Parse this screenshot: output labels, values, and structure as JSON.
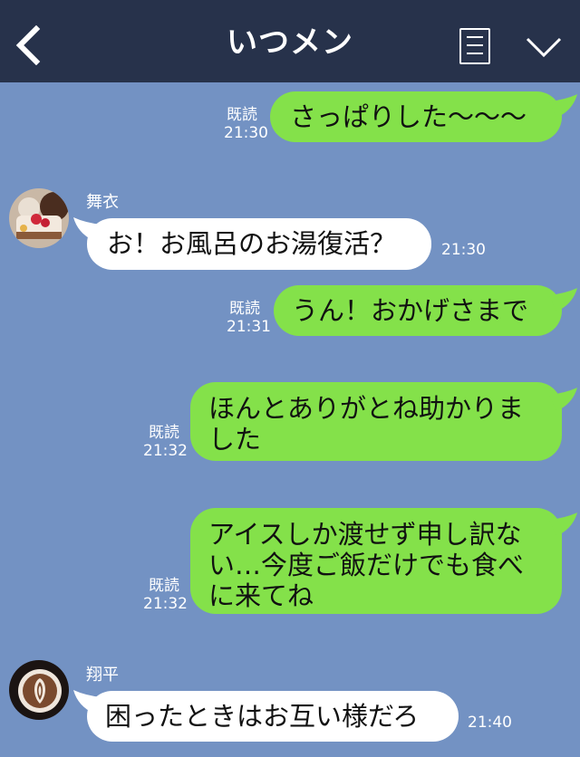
{
  "header": {
    "title": "いつメン"
  },
  "messages": [
    {
      "side": "me",
      "text": "さっぱりした〜〜〜",
      "read": "既読",
      "time": "21:30"
    },
    {
      "side": "them",
      "sender": "舞衣",
      "text": "お！お風呂のお湯復活？",
      "time": "21:30"
    },
    {
      "side": "me",
      "text": "うん！おかげさまで",
      "read": "既読",
      "time": "21:31"
    },
    {
      "side": "me",
      "text": "ほんとありがとね助かりま\nした",
      "read": "既読",
      "time": "21:32"
    },
    {
      "side": "me",
      "text": "アイスしか渡せず申し訳な\nい…今度ご飯だけでも食べ\nに来てね",
      "read": "既読",
      "time": "21:32"
    },
    {
      "side": "them",
      "sender": "翔平",
      "text": "困ったときはお互い様だろ",
      "time": "21:40"
    }
  ],
  "colors": {
    "background": "#7392c3",
    "header": "#27324b",
    "my_bubble": "#84e14a",
    "their_bubble": "#ffffff"
  },
  "icons": {
    "back": "chevron-left-icon",
    "menu": "menu-list-icon",
    "collapse": "chevron-down-icon"
  }
}
